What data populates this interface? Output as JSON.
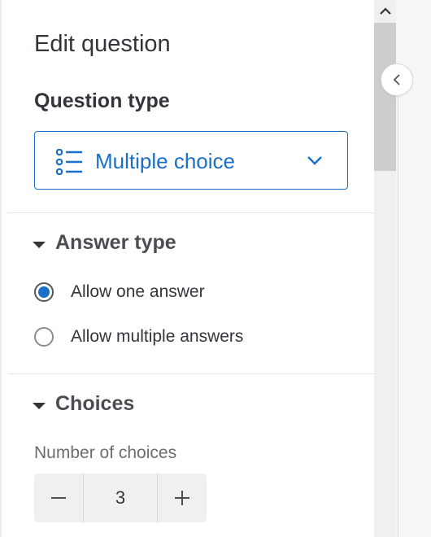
{
  "panel": {
    "title": "Edit question",
    "question_type": {
      "label": "Question type",
      "selected": "Multiple choice",
      "icon": "list-icon",
      "accent": "#1a6fc9"
    },
    "answer_type": {
      "header": "Answer type",
      "options": [
        {
          "label": "Allow one answer",
          "checked": true
        },
        {
          "label": "Allow multiple answers",
          "checked": false
        }
      ]
    },
    "choices": {
      "header": "Choices",
      "number_label": "Number of choices",
      "count": "3"
    }
  },
  "icons": {
    "scroll_up": "chevron-up-icon",
    "collapse": "chevron-left-icon",
    "dropdown": "chevron-down-icon",
    "decrement": "minus-icon",
    "increment": "plus-icon"
  }
}
